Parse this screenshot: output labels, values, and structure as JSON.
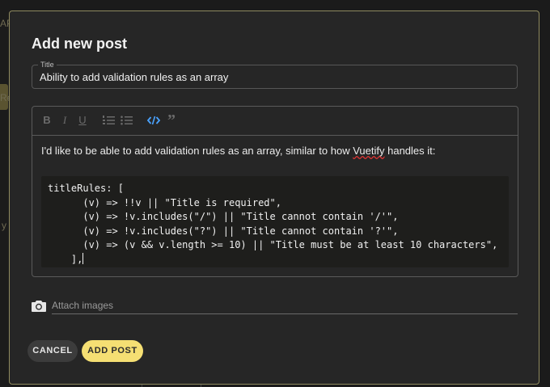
{
  "background": {
    "top_left_fragment": "AP",
    "side_fragment_1": "Re",
    "side_fragment_2": "y"
  },
  "dialog": {
    "title": "Add new post",
    "title_field": {
      "legend": "Title",
      "value": "Ability to add validation rules as an array"
    },
    "editor": {
      "toolbar": [
        {
          "icon": "bold-icon",
          "glyph": "B"
        },
        {
          "icon": "italic-icon",
          "glyph": "I"
        },
        {
          "icon": "underline-icon",
          "glyph": "U"
        },
        {
          "icon": "ordered-list-icon"
        },
        {
          "icon": "bullet-list-icon"
        },
        {
          "icon": "code-icon",
          "active": true
        },
        {
          "icon": "quote-icon",
          "glyph": "”"
        }
      ],
      "paragraph_before": "I'd like to be able to add validation rules as an array, similar to how ",
      "paragraph_misspelled": "Vuetify",
      "paragraph_after": " handles it:",
      "code_lines": [
        "titleRules: [",
        "      (v) => !!v || \"Title is required\",",
        "      (v) => !v.includes(\"/\") || \"Title cannot contain '/'\",",
        "      (v) => !v.includes(\"?\") || \"Title cannot contain '?'\",",
        "      (v) => (v && v.length >= 10) || \"Title must be at least 10 characters\",",
        "    ],"
      ]
    },
    "attach_label": "Attach images",
    "buttons": {
      "cancel": "CANCEL",
      "add": "ADD POST"
    }
  },
  "colors": {
    "accent": "#f5df73",
    "code_active": "#4aa3ff",
    "dialog_border": "#8f8a5f"
  }
}
